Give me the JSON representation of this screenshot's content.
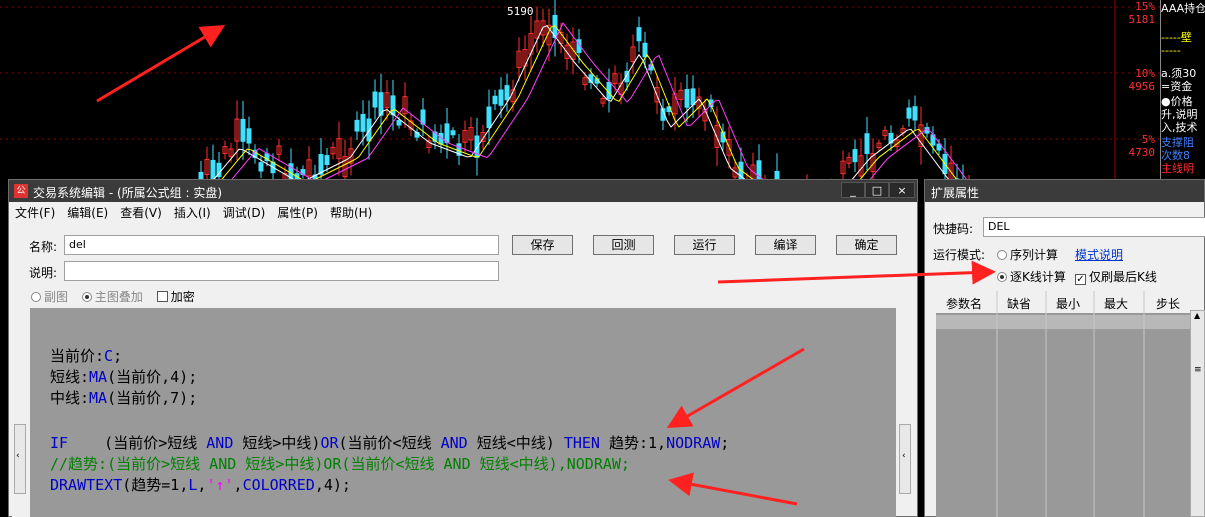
{
  "chart": {
    "price_top": "5190",
    "pct_labels": [
      {
        "pct": "15%",
        "price": "5181"
      },
      {
        "pct": "10%",
        "price": "4956"
      },
      {
        "pct": "5%",
        "price": "4730"
      }
    ]
  },
  "right_panel": {
    "lines": [
      "AAA持仓",
      "-----壁",
      "-----",
      "a.须30",
      "=资金",
      "●价格",
      "升,说明",
      "入,技术",
      "支撑阻",
      "次数8",
      "主线明"
    ]
  },
  "editor": {
    "title": "交易系统编辑 - (所属公式组 : 实盘)",
    "window_buttons": [
      "_",
      "□",
      "×"
    ],
    "menu": [
      "文件(F)",
      "编辑(E)",
      "查看(V)",
      "插入(I)",
      "调试(D)",
      "属性(P)",
      "帮助(H)"
    ],
    "name_label": "名称",
    "name_value": "del",
    "desc_label": "说明",
    "desc_value": "",
    "buttons": [
      "保存",
      "回测",
      "运行",
      "编译",
      "确定"
    ],
    "options": {
      "sub_chart": "副图",
      "main_overlay": "主图叠加",
      "encrypt": "加密"
    },
    "line_marker": "5",
    "code_lines": [
      [
        {
          "t": "当前价:",
          "c": "tx"
        },
        {
          "t": "C",
          "c": "kw"
        },
        {
          "t": ";",
          "c": "tx"
        }
      ],
      [
        {
          "t": "短线:",
          "c": "tx"
        },
        {
          "t": "MA",
          "c": "kw"
        },
        {
          "t": "(当前价,4);",
          "c": "tx"
        }
      ],
      [
        {
          "t": "中线:",
          "c": "tx"
        },
        {
          "t": "MA",
          "c": "kw"
        },
        {
          "t": "(当前价,7);",
          "c": "tx"
        }
      ],
      [],
      [
        {
          "t": "IF",
          "c": "kw"
        },
        {
          "t": "    (当前价>短线 ",
          "c": "tx"
        },
        {
          "t": "AND",
          "c": "kw"
        },
        {
          "t": " 短线>中线)",
          "c": "tx"
        },
        {
          "t": "OR",
          "c": "kw"
        },
        {
          "t": "(当前价<短线 ",
          "c": "tx"
        },
        {
          "t": "AND",
          "c": "kw"
        },
        {
          "t": " 短线<中线) ",
          "c": "tx"
        },
        {
          "t": "THEN",
          "c": "kw"
        },
        {
          "t": " 趋势:1,",
          "c": "tx"
        },
        {
          "t": "NODRAW",
          "c": "kw"
        },
        {
          "t": ";",
          "c": "tx"
        }
      ],
      [
        {
          "t": "//趋势:(当前价>短线 AND 短线>中线)OR(当前价<短线 AND 短线<中线),NODRAW;",
          "c": "cm"
        }
      ],
      [
        {
          "t": "DRAWTEXT",
          "c": "kw"
        },
        {
          "t": "(趋势=1,",
          "c": "tx"
        },
        {
          "t": "L",
          "c": "kw"
        },
        {
          "t": ",",
          "c": "tx"
        },
        {
          "t": "'↑'",
          "c": "mg"
        },
        {
          "t": ",",
          "c": "tx"
        },
        {
          "t": "COLORRED",
          "c": "kw"
        },
        {
          "t": ",4);",
          "c": "tx"
        }
      ]
    ]
  },
  "props": {
    "title": "扩展属性",
    "shortcut_label": "快捷码:",
    "shortcut_value": "DEL",
    "mode_label": "运行模式:",
    "mode_series": "序列计算",
    "mode_link": "模式说明",
    "mode_bar": "逐K线计算",
    "last_bar_only": "仅刷最后K线",
    "param_headers": [
      "参数名",
      "缺省",
      "最小",
      "最大",
      "步长"
    ]
  },
  "colors": {
    "up": "#ff3030",
    "down": "#40e0ff",
    "ma_short": "#ffffff",
    "ma_mid": "#ffff00",
    "ma_long": "#ff40ff",
    "arrow": "#ff2020"
  }
}
